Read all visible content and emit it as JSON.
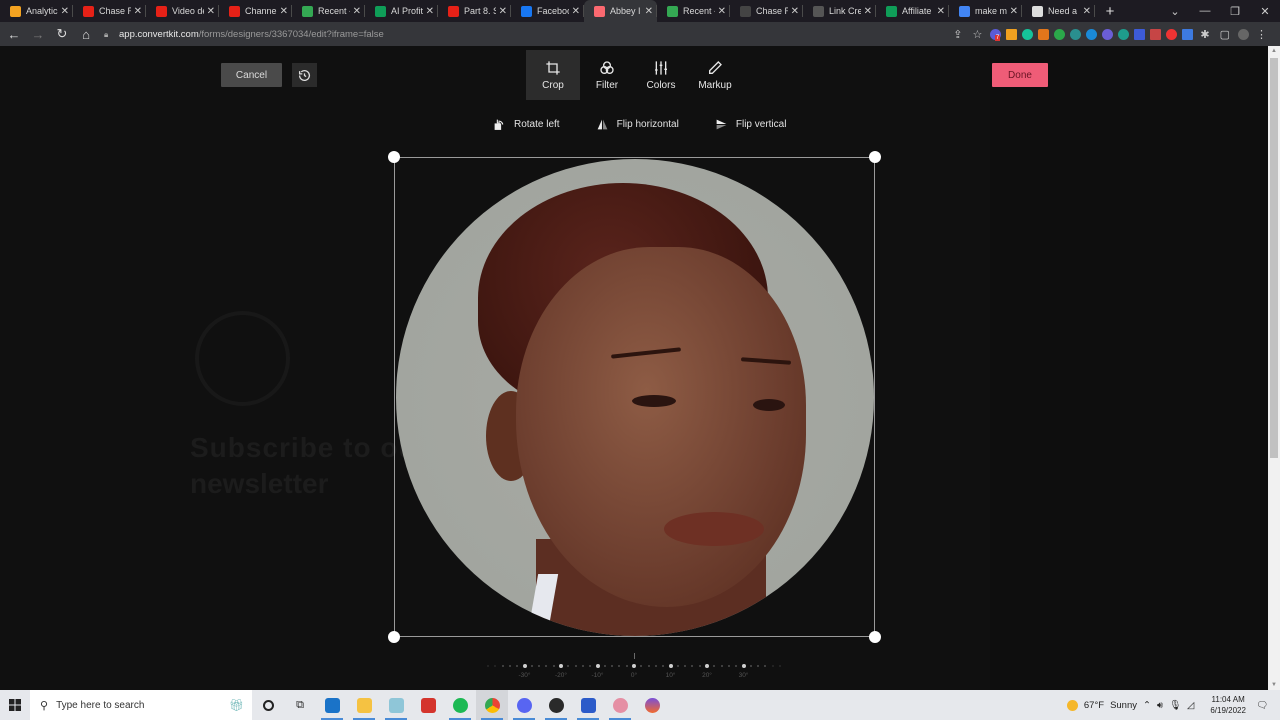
{
  "browser": {
    "tabs": [
      {
        "title": "Analytics",
        "icon": "analytics-icon",
        "color": "#f4a321",
        "active": false
      },
      {
        "title": "Chase R",
        "icon": "youtube-icon",
        "color": "#e62117",
        "active": false
      },
      {
        "title": "Video de",
        "icon": "youtube-icon",
        "color": "#e62117",
        "active": false
      },
      {
        "title": "Channel",
        "icon": "youtube-icon",
        "color": "#e62117",
        "active": false
      },
      {
        "title": "Recent -",
        "icon": "google-drive-icon",
        "color": "#34a853",
        "active": false
      },
      {
        "title": "AI Profit",
        "icon": "google-sheets-icon",
        "color": "#0f9d58",
        "active": false
      },
      {
        "title": "Part 8. S",
        "icon": "youtube-icon",
        "color": "#e62117",
        "active": false
      },
      {
        "title": "Faceboo",
        "icon": "facebook-icon",
        "color": "#1877f2",
        "active": false
      },
      {
        "title": "Abbey I",
        "icon": "convertkit-icon",
        "color": "#fb6970",
        "active": true
      },
      {
        "title": "Recent -",
        "icon": "google-drive-icon",
        "color": "#34a853",
        "active": false
      },
      {
        "title": "Chase R",
        "icon": "person-icon",
        "color": "#444444",
        "active": false
      },
      {
        "title": "Link Cre",
        "icon": "link-icon",
        "color": "#555555",
        "active": false
      },
      {
        "title": "Affiliate",
        "icon": "google-sheets-icon",
        "color": "#0f9d58",
        "active": false
      },
      {
        "title": "make m",
        "icon": "google-icon",
        "color": "#4285f4",
        "active": false
      },
      {
        "title": "Need a",
        "icon": "chatgpt-icon",
        "color": "#dddddd",
        "active": false
      }
    ],
    "url_host": "app.convertkit.com",
    "url_path": "/forms/designers/3367034/edit?iframe=false",
    "extension_badge": "7"
  },
  "editor": {
    "cancel_label": "Cancel",
    "done_label": "Done",
    "done_color": "#ef5c77",
    "tools": [
      {
        "label": "Crop",
        "icon": "crop-icon",
        "active": true
      },
      {
        "label": "Filter",
        "icon": "filter-icon",
        "active": false
      },
      {
        "label": "Colors",
        "icon": "sliders-icon",
        "active": false
      },
      {
        "label": "Markup",
        "icon": "pencil-icon",
        "active": false
      }
    ],
    "crop_actions": [
      {
        "label": "Rotate left",
        "icon": "rotate-left-icon"
      },
      {
        "label": "Flip horizontal",
        "icon": "flip-horizontal-icon"
      },
      {
        "label": "Flip vertical",
        "icon": "flip-vertical-icon"
      }
    ],
    "rotation": {
      "value_deg": 0,
      "labels": [
        "-30°",
        "-20°",
        "-10°",
        "0°",
        "10°",
        "20°",
        "30°"
      ]
    },
    "background_form": {
      "heading_line1": "Subscribe to our",
      "heading_line2": "newsletter"
    }
  },
  "taskbar": {
    "search_placeholder": "Type here to search",
    "weather_temp": "67°F",
    "weather_text": "Sunny",
    "time": "11:04 AM",
    "date": "6/19/2022"
  }
}
